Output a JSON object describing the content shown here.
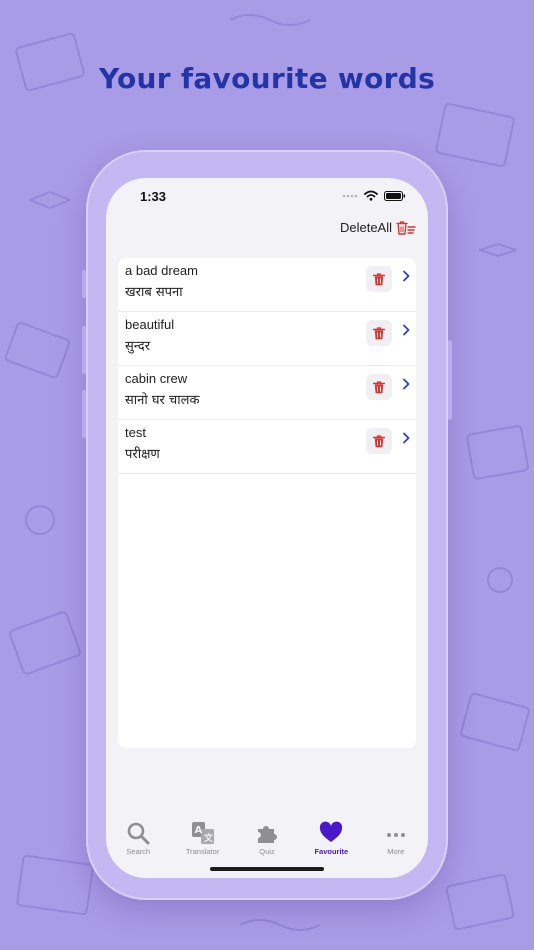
{
  "headline": "Your favourite words",
  "status": {
    "time": "1:33"
  },
  "toolbar": {
    "delete_all_label": "DeleteAll"
  },
  "favourites": [
    {
      "english": "a bad dream",
      "hindi": " खराब सपना"
    },
    {
      "english": "beautiful",
      "hindi": "सुन्दर"
    },
    {
      "english": "cabin crew",
      "hindi": "सानो घर चालक"
    },
    {
      "english": "test",
      "hindi": "परीक्षण"
    }
  ],
  "tabs": [
    {
      "label": "Search",
      "icon": "search-icon"
    },
    {
      "label": "Translator",
      "icon": "translate-icon"
    },
    {
      "label": "Quiz",
      "icon": "puzzle-icon"
    },
    {
      "label": "Favourite",
      "icon": "heart-icon",
      "active": true
    },
    {
      "label": "More",
      "icon": "more-dots-icon"
    }
  ],
  "colors": {
    "background": "#a99ce6",
    "headline": "#2335a6",
    "accent": "#4a17c9",
    "trash": "#e0302a",
    "chevron": "#2b3fc4"
  }
}
